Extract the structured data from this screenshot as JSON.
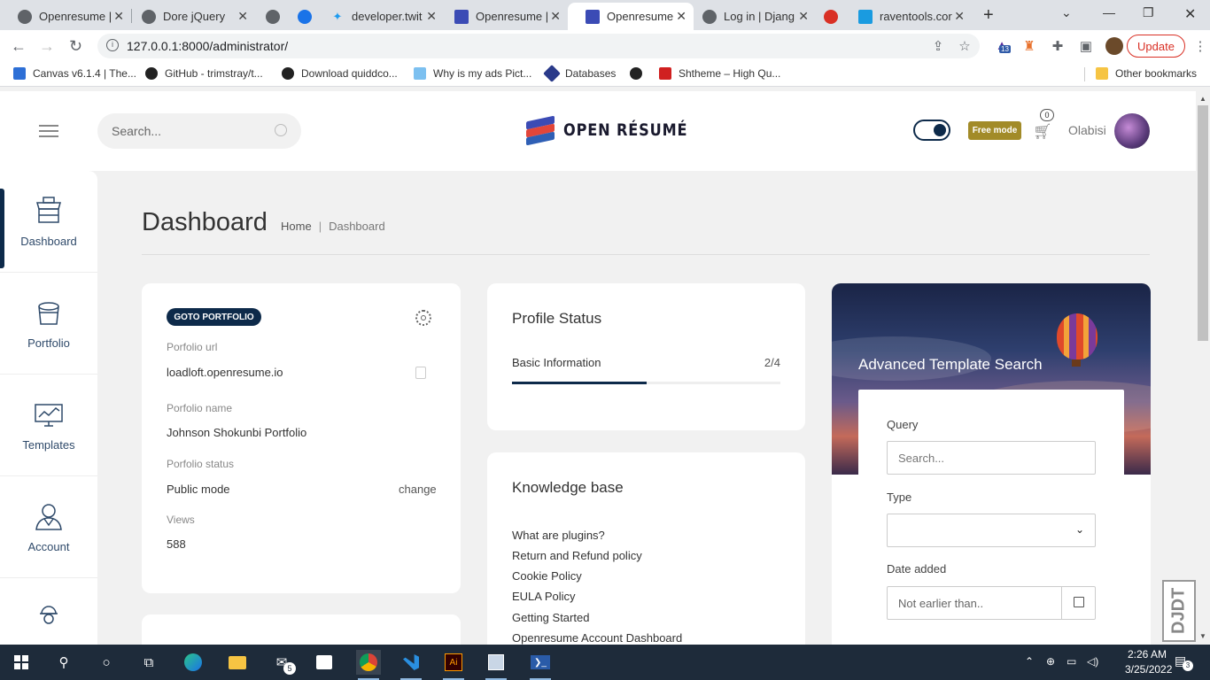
{
  "browser": {
    "tabs": [
      {
        "title": "Openresume |",
        "active": false
      },
      {
        "title": "Dore jQuery",
        "active": false
      },
      {
        "title": "",
        "active": false
      },
      {
        "title": "",
        "active": false
      },
      {
        "title": "developer.twit",
        "active": false
      },
      {
        "title": "Openresume |",
        "active": false
      },
      {
        "title": "Openresume",
        "active": true
      },
      {
        "title": "Log in | Djang",
        "active": false
      },
      {
        "title": "",
        "active": false
      },
      {
        "title": "raventools.cor",
        "active": false
      }
    ],
    "new_tab": "+",
    "url": "127.0.0.1:8000/administrator/",
    "extension_badge": "13",
    "update_label": "Update",
    "bookmarks": [
      "Canvas v6.1.4 | The...",
      "GitHub - trimstray/t...",
      "Download quiddco...",
      "Why is my ads Pict...",
      "Databases",
      "",
      "Shtheme – High Qu...",
      "Other bookmarks"
    ]
  },
  "header": {
    "search_placeholder": "Search...",
    "logo_text": "OPEN RÉSUMÉ",
    "free_mode_label": "Free mode",
    "cart_count": "0",
    "username": "Olabisi"
  },
  "sidebar": {
    "items": [
      {
        "label": "Dashboard",
        "icon": "store-icon",
        "active": true
      },
      {
        "label": "Portfolio",
        "icon": "bucket-icon",
        "active": false
      },
      {
        "label": "Templates",
        "icon": "monitor-icon",
        "active": false
      },
      {
        "label": "Account",
        "icon": "user-icon",
        "active": false
      },
      {
        "label": "",
        "icon": "worker-icon",
        "active": false
      }
    ]
  },
  "page": {
    "title": "Dashboard",
    "breadcrumb": {
      "home": "Home",
      "separator": "|",
      "current": "Dashboard"
    }
  },
  "portfolio_card": {
    "goto_label": "GOTO PORTFOLIO",
    "url_label": "Porfolio url",
    "url_value": "loadloft.openresume.io",
    "name_label": "Porfolio name",
    "name_value": "Johnson Shokunbi Portfolio",
    "status_label": "Porfolio status",
    "status_value": "Public mode",
    "change_label": "change",
    "views_label": "Views",
    "views_value": "588"
  },
  "profile_status": {
    "title": "Profile Status",
    "row_label": "Basic Information",
    "row_count": "2/4",
    "progress_fraction": 0.5
  },
  "knowledge_base": {
    "title": "Knowledge base",
    "links": [
      "What are plugins?",
      "Return and Refund policy",
      "Cookie Policy",
      "EULA Policy",
      "Getting Started",
      "Openresume Account Dashboard"
    ]
  },
  "template_search": {
    "title": "Advanced Template Search",
    "query_label": "Query",
    "query_placeholder": "Search...",
    "type_label": "Type",
    "type_value": "",
    "date_label": "Date added",
    "date_placeholder": "Not earlier than.."
  },
  "debug_toolbar": {
    "label": "DJDT"
  },
  "taskbar": {
    "mail_badge": "5",
    "clock_time": "2:26 AM",
    "clock_date": "3/25/2022",
    "notification_count": "3"
  },
  "colors": {
    "primary": "#0d2a4a",
    "free_mode": "#a28b28",
    "update": "#d93025"
  }
}
